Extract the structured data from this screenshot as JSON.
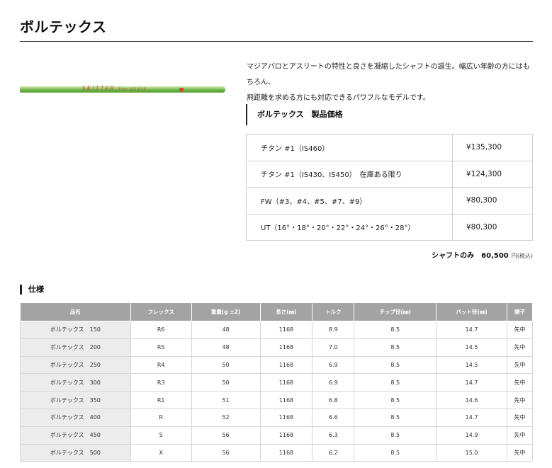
{
  "page": {
    "title": "ボルテックス"
  },
  "product": {
    "shaft_brand": "SKITTER",
    "shaft_small_text": "Tour    IS5 U15",
    "description_line1": "マジアパロとアスリートの特性と良さを凝縮したシャフトの誕生。幅広い年齢の方にはもちろん、",
    "description_line2": "飛距離を求める方にも対応できるパワフルなモデルです。"
  },
  "price_section": {
    "heading": "ボルテックス　製品価格",
    "rows": [
      {
        "name": "チタン #1（IS460）",
        "price": "¥135,300"
      },
      {
        "name": "チタン #1（IS430、IS450）　在庫ある限り",
        "price": "¥124,300"
      },
      {
        "name": "FW（#3、#4、#5、#7、#9）",
        "price": "¥80,300"
      },
      {
        "name": "UT（16°・18°・20°・22°・24°・26°・28°）",
        "price": "¥80,300"
      }
    ],
    "shaft_only_label": "シャフトのみ",
    "shaft_only_amount": "60,500",
    "shaft_only_unit": "円(税込)"
  },
  "spec_section": {
    "heading": "仕様",
    "headers": [
      "品名",
      "フレックス",
      "重量(g ±2)",
      "長さ(㎜)",
      "トルク",
      "チップ径(㎜)",
      "バット径(㎜)",
      "調子"
    ],
    "rows": [
      [
        "ボルテックス　150",
        "R6",
        "48",
        "1168",
        "8.9",
        "8.5",
        "14.7",
        "先中"
      ],
      [
        "ボルテックス　200",
        "R5",
        "48",
        "1168",
        "7.0",
        "8.5",
        "14.5",
        "先中"
      ],
      [
        "ボルテックス　250",
        "R4",
        "50",
        "1168",
        "6.9",
        "8.5",
        "14.5",
        "先中"
      ],
      [
        "ボルテックス　300",
        "R3",
        "50",
        "1168",
        "6.9",
        "8.5",
        "14.7",
        "先中"
      ],
      [
        "ボルテックス　350",
        "R1",
        "51",
        "1168",
        "6.8",
        "8.5",
        "14.6",
        "先中"
      ],
      [
        "ボルテックス　400",
        "R",
        "52",
        "1168",
        "6.6",
        "8.5",
        "14.7",
        "先中"
      ],
      [
        "ボルテックス　450",
        "S",
        "56",
        "1168",
        "6.3",
        "8.5",
        "14.9",
        "先中"
      ],
      [
        "ボルテックス　500",
        "X",
        "56",
        "1168",
        "6.2",
        "8.5",
        "15.0",
        "先中"
      ]
    ]
  },
  "colors": {
    "shaft_green": "#6fb548",
    "shaft_text_red": "#c43b2a",
    "table_header_bg": "#a3a3a3",
    "name_cell_bg": "#ececec"
  }
}
